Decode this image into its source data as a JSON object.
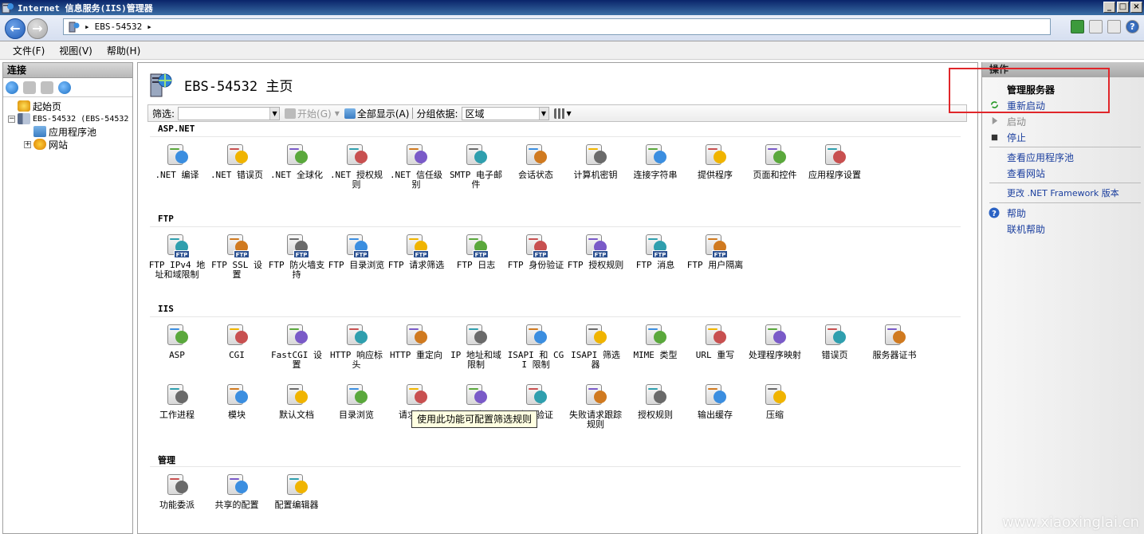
{
  "window": {
    "title": "Internet 信息服务(IIS)管理器"
  },
  "address": {
    "segments": [
      "EBS-54532"
    ]
  },
  "menu": [
    "文件(F)",
    "视图(V)",
    "帮助(H)"
  ],
  "connections": {
    "title": "连接",
    "tree": [
      {
        "label": "起始页"
      },
      {
        "label": "EBS-54532 (EBS-54532"
      },
      {
        "label": "应用程序池"
      },
      {
        "label": "网站"
      }
    ]
  },
  "main": {
    "title": "EBS-54532 主页",
    "filter": {
      "label": "筛选:",
      "start": "开始(G)",
      "show_all": "全部显示(A)",
      "group_by_label": "分组依据:",
      "group_by_value": "区域"
    },
    "groups": [
      {
        "name": "ASP.NET",
        "items": [
          {
            "label": ".NET 编译",
            "icon": "download-icon"
          },
          {
            "label": ".NET 错误页",
            "icon": "warning-404-icon"
          },
          {
            "label": ".NET 全球化",
            "icon": "globe-icon"
          },
          {
            "label": ".NET 授权规则",
            "icon": "lock-doc-icon"
          },
          {
            "label": ".NET 信任级别",
            "icon": "check-globe-icon"
          },
          {
            "label": "SMTP 电子邮件",
            "icon": "email-icon"
          },
          {
            "label": "会话状态",
            "icon": "users-icon"
          },
          {
            "label": "计算机密钥",
            "icon": "server-key-icon"
          },
          {
            "label": "连接字符串",
            "icon": "db-string-icon"
          },
          {
            "label": "提供程序",
            "icon": "provider-icon"
          },
          {
            "label": "页面和控件",
            "icon": "page-controls-icon"
          },
          {
            "label": "应用程序设置",
            "icon": "settings-list-icon"
          }
        ]
      },
      {
        "name": "FTP",
        "items": [
          {
            "label": "FTP IPv4 地址和域限制",
            "icon": "ftp-ip-icon"
          },
          {
            "label": "FTP SSL 设置",
            "icon": "ftp-lock-icon"
          },
          {
            "label": "FTP 防火墙支持",
            "icon": "ftp-firewall-icon"
          },
          {
            "label": "FTP 目录浏览",
            "icon": "ftp-browse-icon"
          },
          {
            "label": "FTP 请求筛选",
            "icon": "ftp-filter-icon"
          },
          {
            "label": "FTP 日志",
            "icon": "ftp-log-icon"
          },
          {
            "label": "FTP 身份验证",
            "icon": "ftp-auth-icon"
          },
          {
            "label": "FTP 授权规则",
            "icon": "ftp-authz-icon"
          },
          {
            "label": "FTP 消息",
            "icon": "ftp-message-icon"
          },
          {
            "label": "FTP 用户隔离",
            "icon": "ftp-isolation-icon"
          }
        ]
      },
      {
        "name": "IIS",
        "items": [
          {
            "label": "ASP",
            "icon": "asp-icon"
          },
          {
            "label": "CGI",
            "icon": "cgi-icon"
          },
          {
            "label": "FastCGI 设置",
            "icon": "fastcgi-icon"
          },
          {
            "label": "HTTP 响应标头",
            "icon": "http-header-icon"
          },
          {
            "label": "HTTP 重定向",
            "icon": "redirect-icon"
          },
          {
            "label": "IP 地址和域限制",
            "icon": "ip-restrict-icon"
          },
          {
            "label": "ISAPI 和 CGI 限制",
            "icon": "isapi-cgi-icon"
          },
          {
            "label": "ISAPI 筛选器",
            "icon": "isapi-filter-icon"
          },
          {
            "label": "MIME 类型",
            "icon": "mime-icon"
          },
          {
            "label": "URL 重写",
            "icon": "url-rewrite-icon"
          },
          {
            "label": "处理程序映射",
            "icon": "handler-icon"
          },
          {
            "label": "错误页",
            "icon": "error-page-icon"
          },
          {
            "label": "服务器证书",
            "icon": "certificate-icon"
          },
          {
            "label": "工作进程",
            "icon": "worker-icon"
          },
          {
            "label": "模块",
            "icon": "modules-icon"
          },
          {
            "label": "默认文档",
            "icon": "default-doc-icon"
          },
          {
            "label": "目录浏览",
            "icon": "dir-browse-icon"
          },
          {
            "label": "请求筛选",
            "icon": "request-filter-icon"
          },
          {
            "label": "日志",
            "icon": "log-icon"
          },
          {
            "label": "身份验证",
            "icon": "auth-icon"
          },
          {
            "label": "失败请求跟踪规则",
            "icon": "failed-req-icon"
          },
          {
            "label": "授权规则",
            "icon": "authz-icon"
          },
          {
            "label": "输出缓存",
            "icon": "output-cache-icon"
          },
          {
            "label": "压缩",
            "icon": "compress-icon"
          }
        ]
      },
      {
        "name": "管理",
        "items": [
          {
            "label": "功能委派",
            "icon": "delegation-icon"
          },
          {
            "label": "共享的配置",
            "icon": "shared-config-icon"
          },
          {
            "label": "配置编辑器",
            "icon": "config-editor-icon"
          }
        ]
      }
    ],
    "tooltip": "使用此功能可配置筛选规则",
    "visible_labels": {
      "request_filter_partial": "请",
      "auth_partial": "验证"
    }
  },
  "actions": {
    "title": "操作",
    "section": "管理服务器",
    "restart": "重新启动",
    "start": "启动",
    "stop": "停止",
    "view_pools": "查看应用程序池",
    "view_sites": "查看网站",
    "change_framework": "更改 .NET Framework 版本",
    "help": "帮助",
    "online_help": "联机帮助"
  },
  "watermark": "www.xiaoxinglai.cn",
  "colors": {
    "highlight_box": "#e0262a",
    "link": "#1a3e9e"
  }
}
